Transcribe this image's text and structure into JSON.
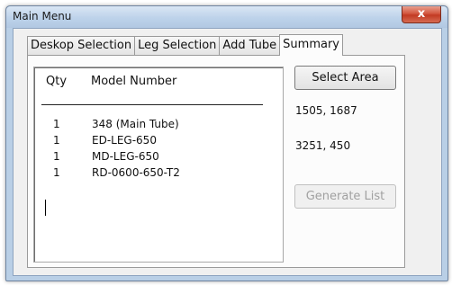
{
  "window": {
    "title": "Main Menu",
    "close_label": "x"
  },
  "tabs": [
    {
      "label": "Deskop Selection"
    },
    {
      "label": "Leg Selection"
    },
    {
      "label": "Add Tube"
    },
    {
      "label": "Summary",
      "active": true
    }
  ],
  "list": {
    "headers": {
      "qty": "Qty",
      "model": "Model Number"
    },
    "rows": [
      {
        "qty": "1",
        "model": "348 (Main Tube)"
      },
      {
        "qty": "1",
        "model": "ED-LEG-650"
      },
      {
        "qty": "1",
        "model": "MD-LEG-650"
      },
      {
        "qty": "1",
        "model": "RD-0600-650-T2"
      }
    ]
  },
  "buttons": {
    "select_area": "Select Area",
    "generate_list": "Generate List"
  },
  "coordinates": {
    "first": "1505, 1687",
    "second": "3251, 450"
  }
}
